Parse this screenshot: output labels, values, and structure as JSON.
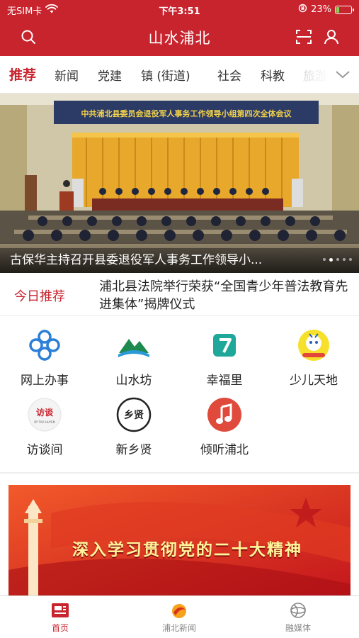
{
  "status_bar": {
    "carrier": "无SIM卡",
    "time": "下午3:51",
    "battery_percent": 23,
    "battery_label": "23%",
    "battery_color": "#7ed957"
  },
  "header": {
    "title": "山水浦北",
    "background_color": "#c8242e",
    "left_icon": "search-icon",
    "right_icons": [
      "scan-icon",
      "user-icon"
    ]
  },
  "tabs": {
    "items": [
      "推荐",
      "新闻",
      "党建",
      "镇 (街道)",
      "社会",
      "科教",
      "旅游"
    ],
    "active": "推荐",
    "more_icon": "chevron-down-icon"
  },
  "hero": {
    "caption": "古保华主持召开县委退役军人事务工作领导小...",
    "banner_text": "中共浦北县委员会退役军人事务工作领导小组第四次全体会议",
    "slide_count": 5,
    "current_slide": 2
  },
  "today": {
    "label": "今日推荐",
    "headline": "浦北县法院举行荣获“全国青少年普法教育先进集体”揭牌仪式"
  },
  "services": [
    {
      "label": "网上办事",
      "icon": "clover-knot-icon"
    },
    {
      "label": "山水坊",
      "icon": "mountain-icon"
    },
    {
      "label": "幸福里",
      "icon": "number-seven-icon"
    },
    {
      "label": "少儿天地",
      "icon": "cartoon-mascot-icon"
    },
    {
      "label": "访谈间",
      "icon": "interview-logo-icon",
      "logo_text": "访谈",
      "logo_subtext": "BY TAO HUYEN"
    },
    {
      "label": "新乡贤",
      "icon": "calligraphy-logo-icon",
      "logo_text": "乡贤"
    },
    {
      "label": "倾听浦北",
      "icon": "music-note-icon"
    }
  ],
  "promo": {
    "text": "深入学习贯彻党的二十大精神"
  },
  "bottom_nav": {
    "items": [
      {
        "label": "首页",
        "icon": "news-icon",
        "active": true
      },
      {
        "label": "浦北新闻",
        "icon": "logo-icon",
        "active": false
      },
      {
        "label": "融媒体",
        "icon": "globe-icon",
        "active": false
      }
    ],
    "accent_color": "#c8242e"
  }
}
